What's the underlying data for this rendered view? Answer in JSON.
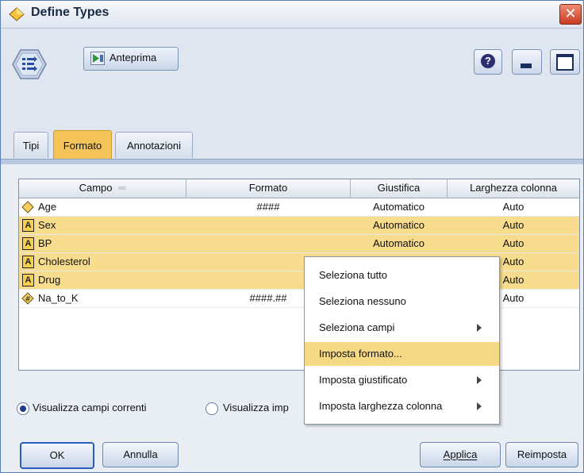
{
  "window": {
    "title": "Define Types",
    "close_glyph": "✕",
    "help_glyph": "?"
  },
  "toolbar": {
    "preview_label": "Anteprima"
  },
  "tabs": [
    {
      "label": "Tipi"
    },
    {
      "label": "Formato",
      "active": true
    },
    {
      "label": "Annotazioni"
    }
  ],
  "table": {
    "columns": [
      "Campo",
      "Formato",
      "Giustifica",
      "Larghezza colonna"
    ],
    "rows": [
      {
        "icon": "continuous-diamond-icon",
        "field": "Age",
        "format": "####",
        "justify": "Automatico",
        "width": "Auto",
        "highlighted": false
      },
      {
        "icon": "text-a-icon",
        "icon_glyph": "A",
        "field": "Sex",
        "format": "",
        "justify": "Automatico",
        "width": "Auto",
        "highlighted": true
      },
      {
        "icon": "text-a-icon",
        "icon_glyph": "A",
        "field": "BP",
        "format": "",
        "justify": "Automatico",
        "width": "Auto",
        "highlighted": true
      },
      {
        "icon": "text-a-icon",
        "icon_glyph": "A",
        "field": "Cholesterol",
        "format": "",
        "justify": "",
        "width": "Auto",
        "highlighted": true
      },
      {
        "icon": "text-a-icon",
        "icon_glyph": "A",
        "field": "Drug",
        "format": "",
        "justify": "",
        "width": "Auto",
        "highlighted": true
      },
      {
        "icon": "numeric-hash-icon",
        "field": "Na_to_K",
        "format": "####.##",
        "justify": "",
        "width": "Auto",
        "highlighted": false
      }
    ]
  },
  "context_menu": {
    "items": [
      {
        "label": "Seleziona tutto",
        "submenu": false,
        "selected": false
      },
      {
        "label": "Seleziona nessuno",
        "submenu": false,
        "selected": false
      },
      {
        "label": "Seleziona campi",
        "submenu": true,
        "selected": false
      },
      {
        "label": "Imposta formato...",
        "submenu": false,
        "selected": true
      },
      {
        "label": "Imposta giustificato",
        "submenu": true,
        "selected": false
      },
      {
        "label": "Imposta larghezza colonna",
        "submenu": true,
        "selected": false
      }
    ]
  },
  "view_options": {
    "current_fields": "Visualizza campi correnti",
    "other_option_partial": "Visualizza imp"
  },
  "buttons": {
    "ok": "OK",
    "cancel": "Annulla",
    "apply": "Applica",
    "reset": "Reimposta"
  },
  "colors": {
    "accent_tab": "#f4c45a",
    "row_highlight": "#f7dc8e",
    "menu_selected": "#f6d984"
  }
}
